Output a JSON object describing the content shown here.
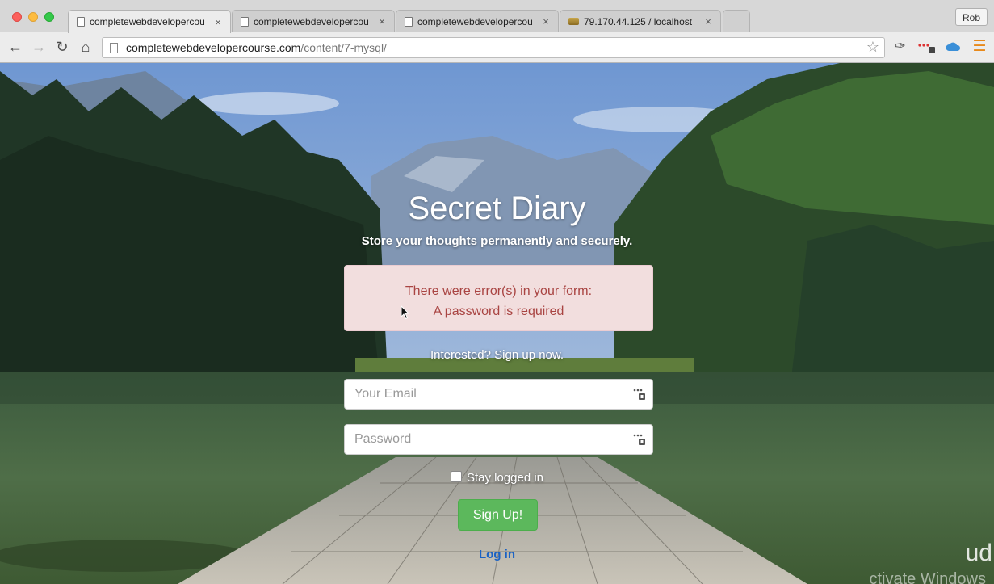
{
  "browser": {
    "tabs": [
      {
        "title": "completewebdevelopercou",
        "active": true
      },
      {
        "title": "completewebdevelopercou",
        "active": false
      },
      {
        "title": "completewebdevelopercou",
        "active": false
      },
      {
        "title": "79.170.44.125 / localhost",
        "active": false
      }
    ],
    "close_glyph": "×",
    "profile_name": "Rob",
    "url_host": "completewebdevelopercourse.com",
    "url_path": "/content/7-mysql/"
  },
  "page": {
    "heading": "Secret Diary",
    "tagline": "Store your thoughts permanently and securely.",
    "alert": {
      "line1": "There were error(s) in your form:",
      "line2": "A password is required"
    },
    "signup_prompt": "Interested? Sign up now.",
    "email_placeholder": "Your Email",
    "password_placeholder": "Password",
    "remember_label": "Stay logged in",
    "signup_button": "Sign Up!",
    "login_link": "Log in"
  },
  "overlay": {
    "watermark_logo": "ud",
    "watermark_windows": "ctivate Windows"
  },
  "colors": {
    "alert_bg": "#f2dede",
    "alert_text": "#a94442",
    "button_green": "#5cb85c",
    "link_blue": "#1a62c4"
  }
}
